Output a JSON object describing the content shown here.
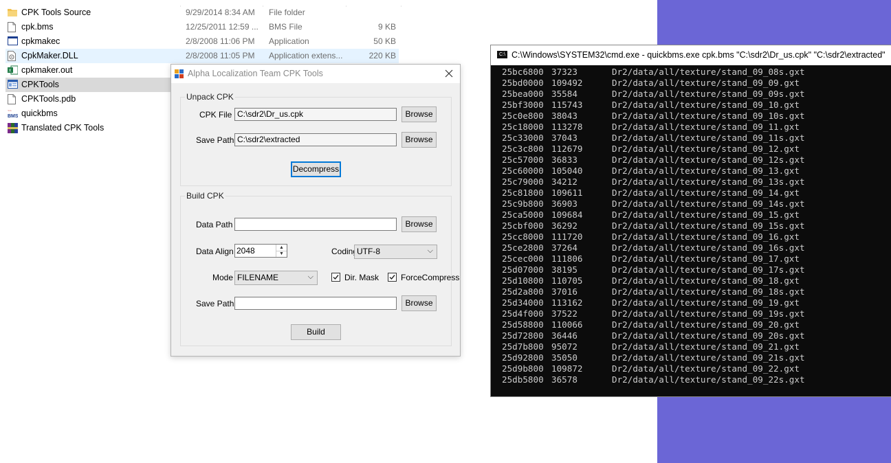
{
  "explorer": {
    "files": [
      {
        "name": "CPK Tools Source",
        "date": "9/29/2014 8:34 AM",
        "type": "File folder",
        "size": "",
        "icon": "folder-icon",
        "state": ""
      },
      {
        "name": "cpk.bms",
        "date": "12/25/2011 12:59 ...",
        "type": "BMS File",
        "size": "9 KB",
        "icon": "document-icon",
        "state": ""
      },
      {
        "name": "cpkmakec",
        "date": "2/8/2008 11:06 PM",
        "type": "Application",
        "size": "50 KB",
        "icon": "application-icon",
        "state": ""
      },
      {
        "name": "CpkMaker.DLL",
        "date": "2/8/2008 11:05 PM",
        "type": "Application extens...",
        "size": "220 KB",
        "icon": "dll-icon",
        "state": "hover"
      },
      {
        "name": "cpkmaker.out",
        "date": "",
        "type": "",
        "size": "",
        "icon": "spreadsheet-icon",
        "state": ""
      },
      {
        "name": "CPKTools",
        "date": "",
        "type": "",
        "size": "",
        "icon": "window-app-icon",
        "state": "selected"
      },
      {
        "name": "CPKTools.pdb",
        "date": "",
        "type": "",
        "size": "",
        "icon": "document-icon",
        "state": ""
      },
      {
        "name": "quickbms",
        "date": "",
        "type": "",
        "size": "",
        "icon": "bms-icon",
        "state": ""
      },
      {
        "name": "Translated CPK Tools",
        "date": "",
        "type": "",
        "size": "",
        "icon": "archive-icon",
        "state": ""
      }
    ]
  },
  "dialog": {
    "title": "Alpha Localization Team CPK Tools",
    "unpack": {
      "group_title": "Unpack CPK",
      "cpk_file_label": "CPK File",
      "cpk_file_value": "C:\\sdr2\\Dr_us.cpk",
      "save_path_label": "Save Path",
      "save_path_value": "C:\\sdr2\\extracted",
      "browse_label": "Browse",
      "decompress_label": "Decompress"
    },
    "build": {
      "group_title": "Build CPK",
      "data_path_label": "Data Path",
      "data_path_value": "",
      "data_align_label": "Data Align",
      "data_align_value": "2048",
      "coding_label": "Coding",
      "coding_value": "UTF-8",
      "mode_label": "Mode",
      "mode_value": "FILENAME",
      "dir_mask_label": "Dir. Mask",
      "dir_mask_checked": true,
      "force_compress_label": "ForceCompress",
      "force_compress_checked": true,
      "save_path_label": "Save Path",
      "save_path_value": "",
      "browse_label": "Browse",
      "build_label": "Build"
    }
  },
  "console": {
    "title": "C:\\Windows\\SYSTEM32\\cmd.exe - quickbms.exe  cpk.bms \"C:\\sdr2\\Dr_us.cpk\" \"C:\\sdr2\\extracted\"",
    "lines": [
      [
        "25bc6800",
        "37323",
        "Dr2/data/all/texture/stand_09_08s.gxt"
      ],
      [
        "25bd0000",
        "109492",
        "Dr2/data/all/texture/stand_09_09.gxt"
      ],
      [
        "25bea000",
        "35584",
        "Dr2/data/all/texture/stand_09_09s.gxt"
      ],
      [
        "25bf3000",
        "115743",
        "Dr2/data/all/texture/stand_09_10.gxt"
      ],
      [
        "25c0e800",
        "38043",
        "Dr2/data/all/texture/stand_09_10s.gxt"
      ],
      [
        "25c18000",
        "113278",
        "Dr2/data/all/texture/stand_09_11.gxt"
      ],
      [
        "25c33000",
        "37043",
        "Dr2/data/all/texture/stand_09_11s.gxt"
      ],
      [
        "25c3c800",
        "112679",
        "Dr2/data/all/texture/stand_09_12.gxt"
      ],
      [
        "25c57000",
        "36833",
        "Dr2/data/all/texture/stand_09_12s.gxt"
      ],
      [
        "25c60000",
        "105040",
        "Dr2/data/all/texture/stand_09_13.gxt"
      ],
      [
        "25c79000",
        "34212",
        "Dr2/data/all/texture/stand_09_13s.gxt"
      ],
      [
        "25c81800",
        "109611",
        "Dr2/data/all/texture/stand_09_14.gxt"
      ],
      [
        "25c9b800",
        "36903",
        "Dr2/data/all/texture/stand_09_14s.gxt"
      ],
      [
        "25ca5000",
        "109684",
        "Dr2/data/all/texture/stand_09_15.gxt"
      ],
      [
        "25cbf000",
        "36292",
        "Dr2/data/all/texture/stand_09_15s.gxt"
      ],
      [
        "25cc8000",
        "111720",
        "Dr2/data/all/texture/stand_09_16.gxt"
      ],
      [
        "25ce2800",
        "37264",
        "Dr2/data/all/texture/stand_09_16s.gxt"
      ],
      [
        "25cec000",
        "111806",
        "Dr2/data/all/texture/stand_09_17.gxt"
      ],
      [
        "25d07000",
        "38195",
        "Dr2/data/all/texture/stand_09_17s.gxt"
      ],
      [
        "25d10800",
        "110705",
        "Dr2/data/all/texture/stand_09_18.gxt"
      ],
      [
        "25d2a800",
        "37016",
        "Dr2/data/all/texture/stand_09_18s.gxt"
      ],
      [
        "25d34000",
        "113162",
        "Dr2/data/all/texture/stand_09_19.gxt"
      ],
      [
        "25d4f000",
        "37522",
        "Dr2/data/all/texture/stand_09_19s.gxt"
      ],
      [
        "25d58800",
        "110066",
        "Dr2/data/all/texture/stand_09_20.gxt"
      ],
      [
        "25d72800",
        "36446",
        "Dr2/data/all/texture/stand_09_20s.gxt"
      ],
      [
        "25d7b800",
        "95072",
        "Dr2/data/all/texture/stand_09_21.gxt"
      ],
      [
        "25d92800",
        "35050",
        "Dr2/data/all/texture/stand_09_21s.gxt"
      ],
      [
        "25d9b800",
        "109872",
        "Dr2/data/all/texture/stand_09_22.gxt"
      ],
      [
        "25db5800",
        "36578",
        "Dr2/data/all/texture/stand_09_22s.gxt"
      ]
    ]
  },
  "colors": {
    "desktop": "#6b66d6",
    "console_bg": "#0c0c0c",
    "console_text": "#cccccc",
    "selected_row": "#d9d9d9",
    "hover_row": "#e5f3ff",
    "focus_border": "#0078d7"
  }
}
